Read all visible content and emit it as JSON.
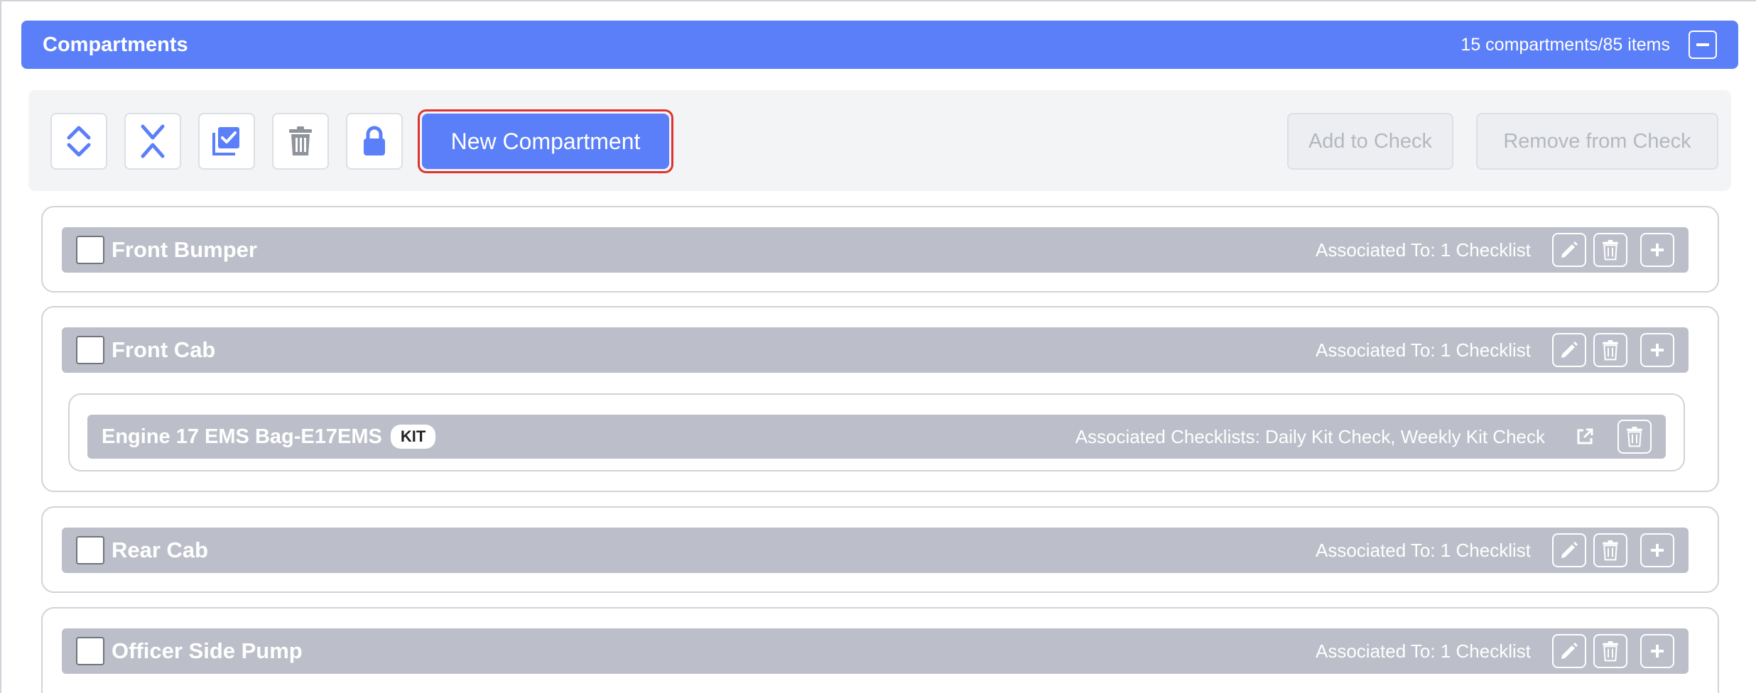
{
  "panel": {
    "title": "Compartments",
    "count": "15 compartments/85 items"
  },
  "toolbar": {
    "new_label": "New Compartment",
    "add_label": "Add to Check",
    "remove_label": "Remove from Check"
  },
  "compartments": [
    {
      "name": "Front Bumper",
      "assoc": "Associated To: 1 Checklist"
    },
    {
      "name": "Front Cab",
      "assoc": "Associated To: 1 Checklist",
      "items": [
        {
          "name": "Engine 17 EMS Bag-E17EMS",
          "badge": "KIT",
          "assoc": "Associated Checklists: Daily Kit Check, Weekly Kit Check"
        }
      ]
    },
    {
      "name": "Rear Cab",
      "assoc": "Associated To: 1 Checklist"
    },
    {
      "name": "Officer Side Pump",
      "assoc": "Associated To: 1 Checklist"
    }
  ],
  "colors": {
    "accent": "#5b7ff8",
    "row_bg": "#bcbfc9",
    "highlight": "#e0332f"
  }
}
